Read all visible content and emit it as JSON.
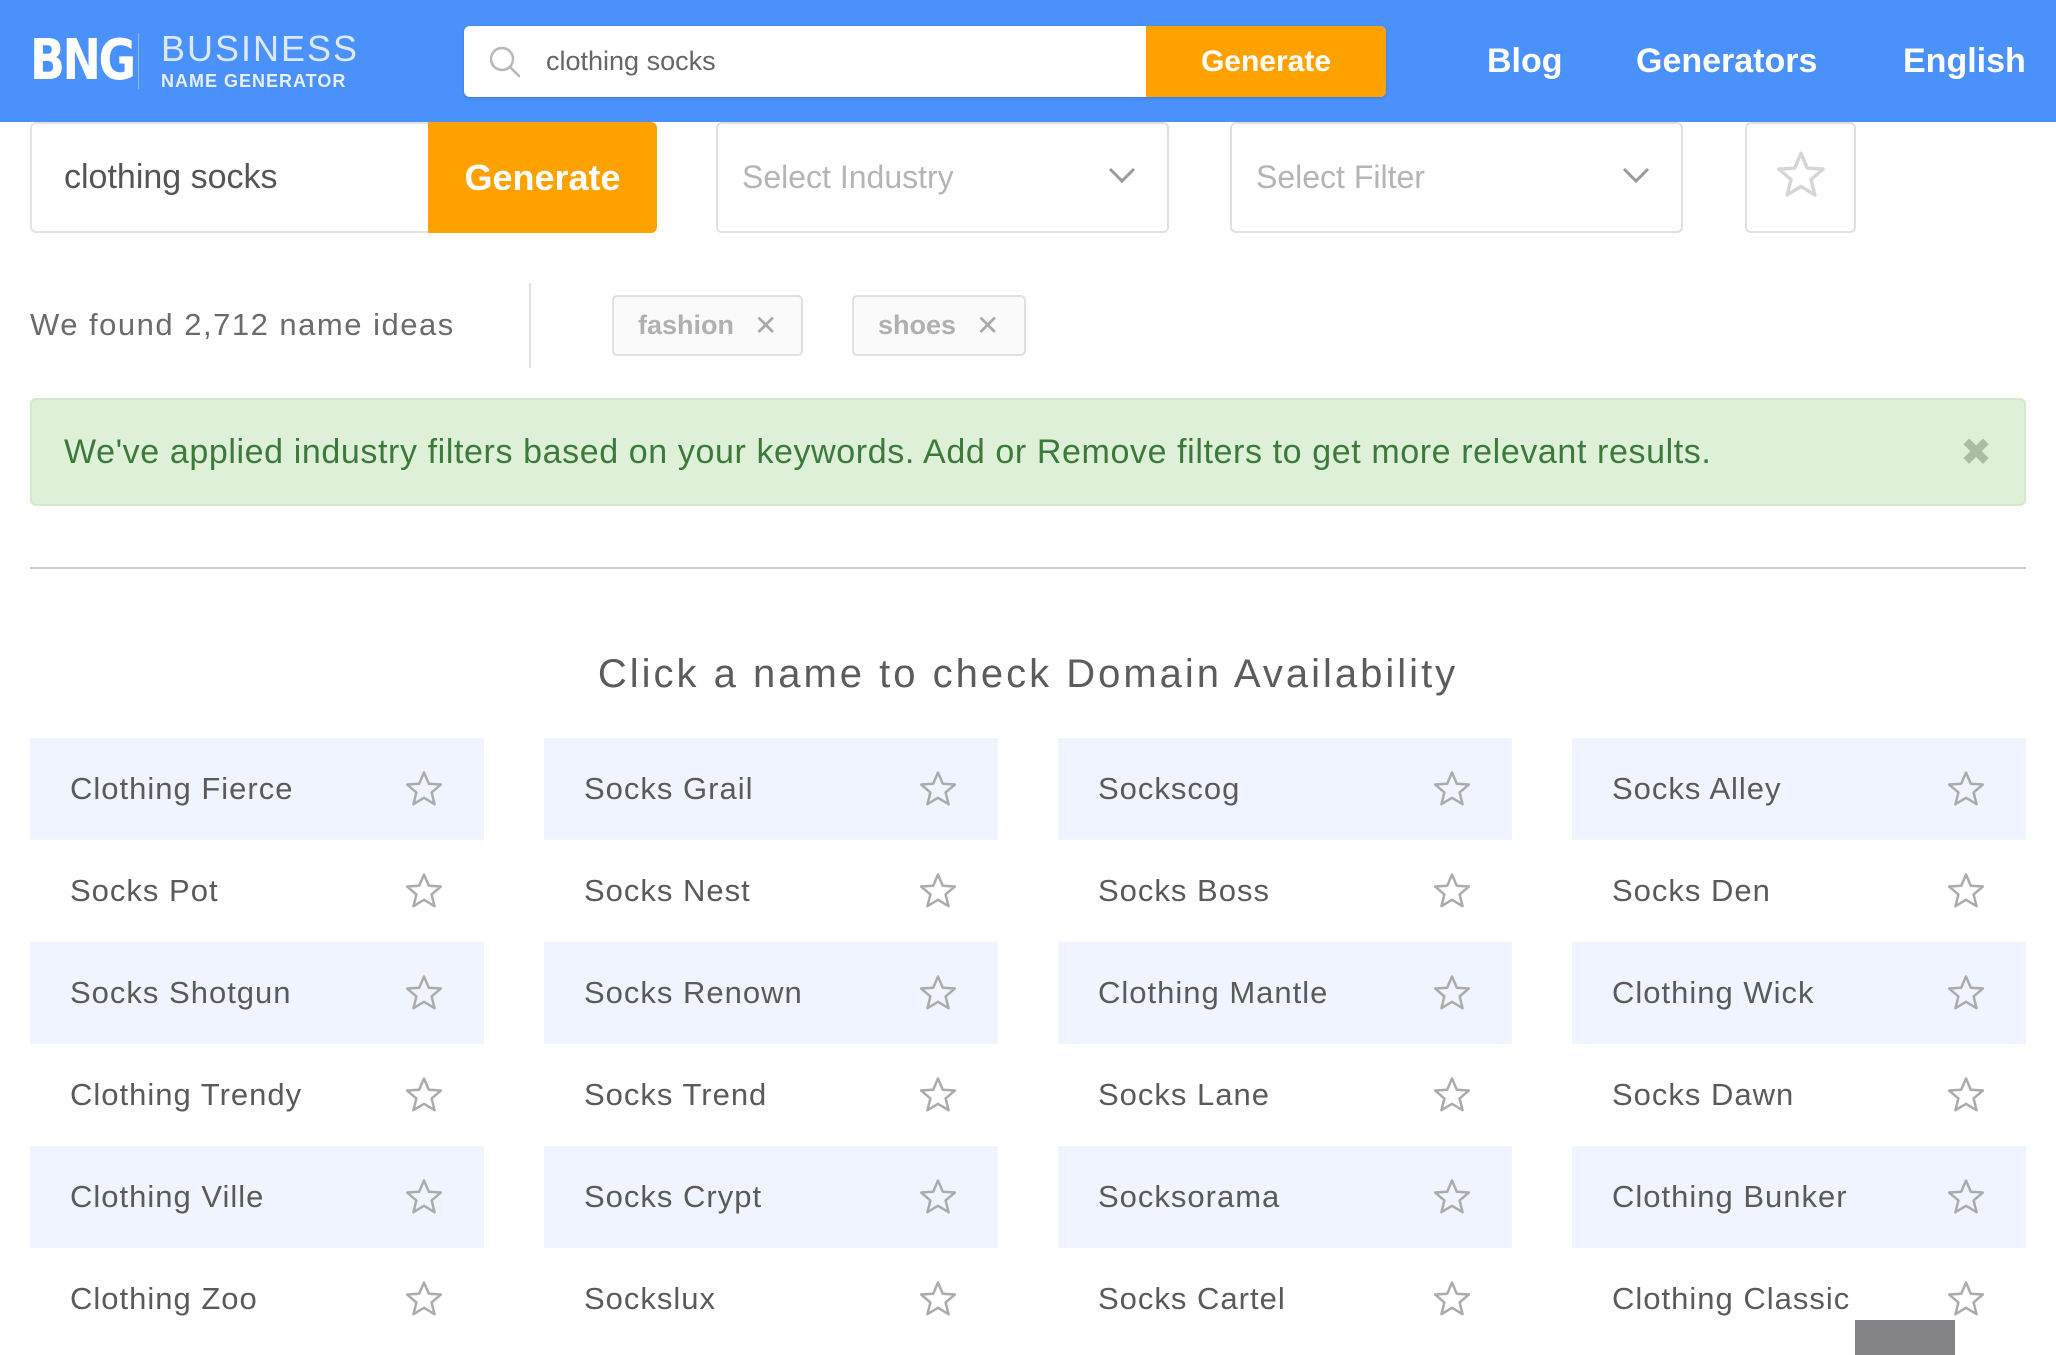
{
  "header": {
    "logo_mark": "BNG",
    "logo_title": "BUSINESS",
    "logo_subtitle": "NAME GENERATOR",
    "search_value": "clothing socks",
    "search_button": "Generate",
    "nav": [
      {
        "label": "Blog"
      },
      {
        "label": "Generators"
      },
      {
        "label": "English"
      }
    ],
    "colors": {
      "background": "#4a91fb",
      "accent": "#ffa200"
    }
  },
  "search_bar": {
    "value": "clothing socks",
    "button": "Generate",
    "industry_select": {
      "placeholder": "Select Industry"
    },
    "filter_select": {
      "placeholder": "Select Filter"
    },
    "favorites_icon": "star-outline-icon"
  },
  "results": {
    "summary": "We found 2,712 name ideas",
    "tags": [
      {
        "label": "fashion",
        "remove": "✕"
      },
      {
        "label": "shoes",
        "remove": "✕"
      }
    ]
  },
  "alert": {
    "message": "We've applied industry filters based on your keywords. Add or Remove filters to get more relevant results.",
    "close": "✖",
    "colors": {
      "background": "#dff0d8",
      "text": "#3c7a3c"
    }
  },
  "names_section": {
    "heading": "Click a name to check Domain Availability",
    "names": [
      "Clothing Fierce",
      "Socks Grail",
      "Sockscog",
      "Socks Alley",
      "Socks Pot",
      "Socks Nest",
      "Socks Boss",
      "Socks Den",
      "Socks Shotgun",
      "Socks Renown",
      "Clothing Mantle",
      "Clothing Wick",
      "Clothing Trendy",
      "Socks Trend",
      "Socks Lane",
      "Socks Dawn",
      "Clothing Ville",
      "Socks Crypt",
      "Socksorama",
      "Clothing Bunker",
      "Clothing Zoo",
      "Sockslux",
      "Socks Cartel",
      "Clothing Classic"
    ]
  }
}
